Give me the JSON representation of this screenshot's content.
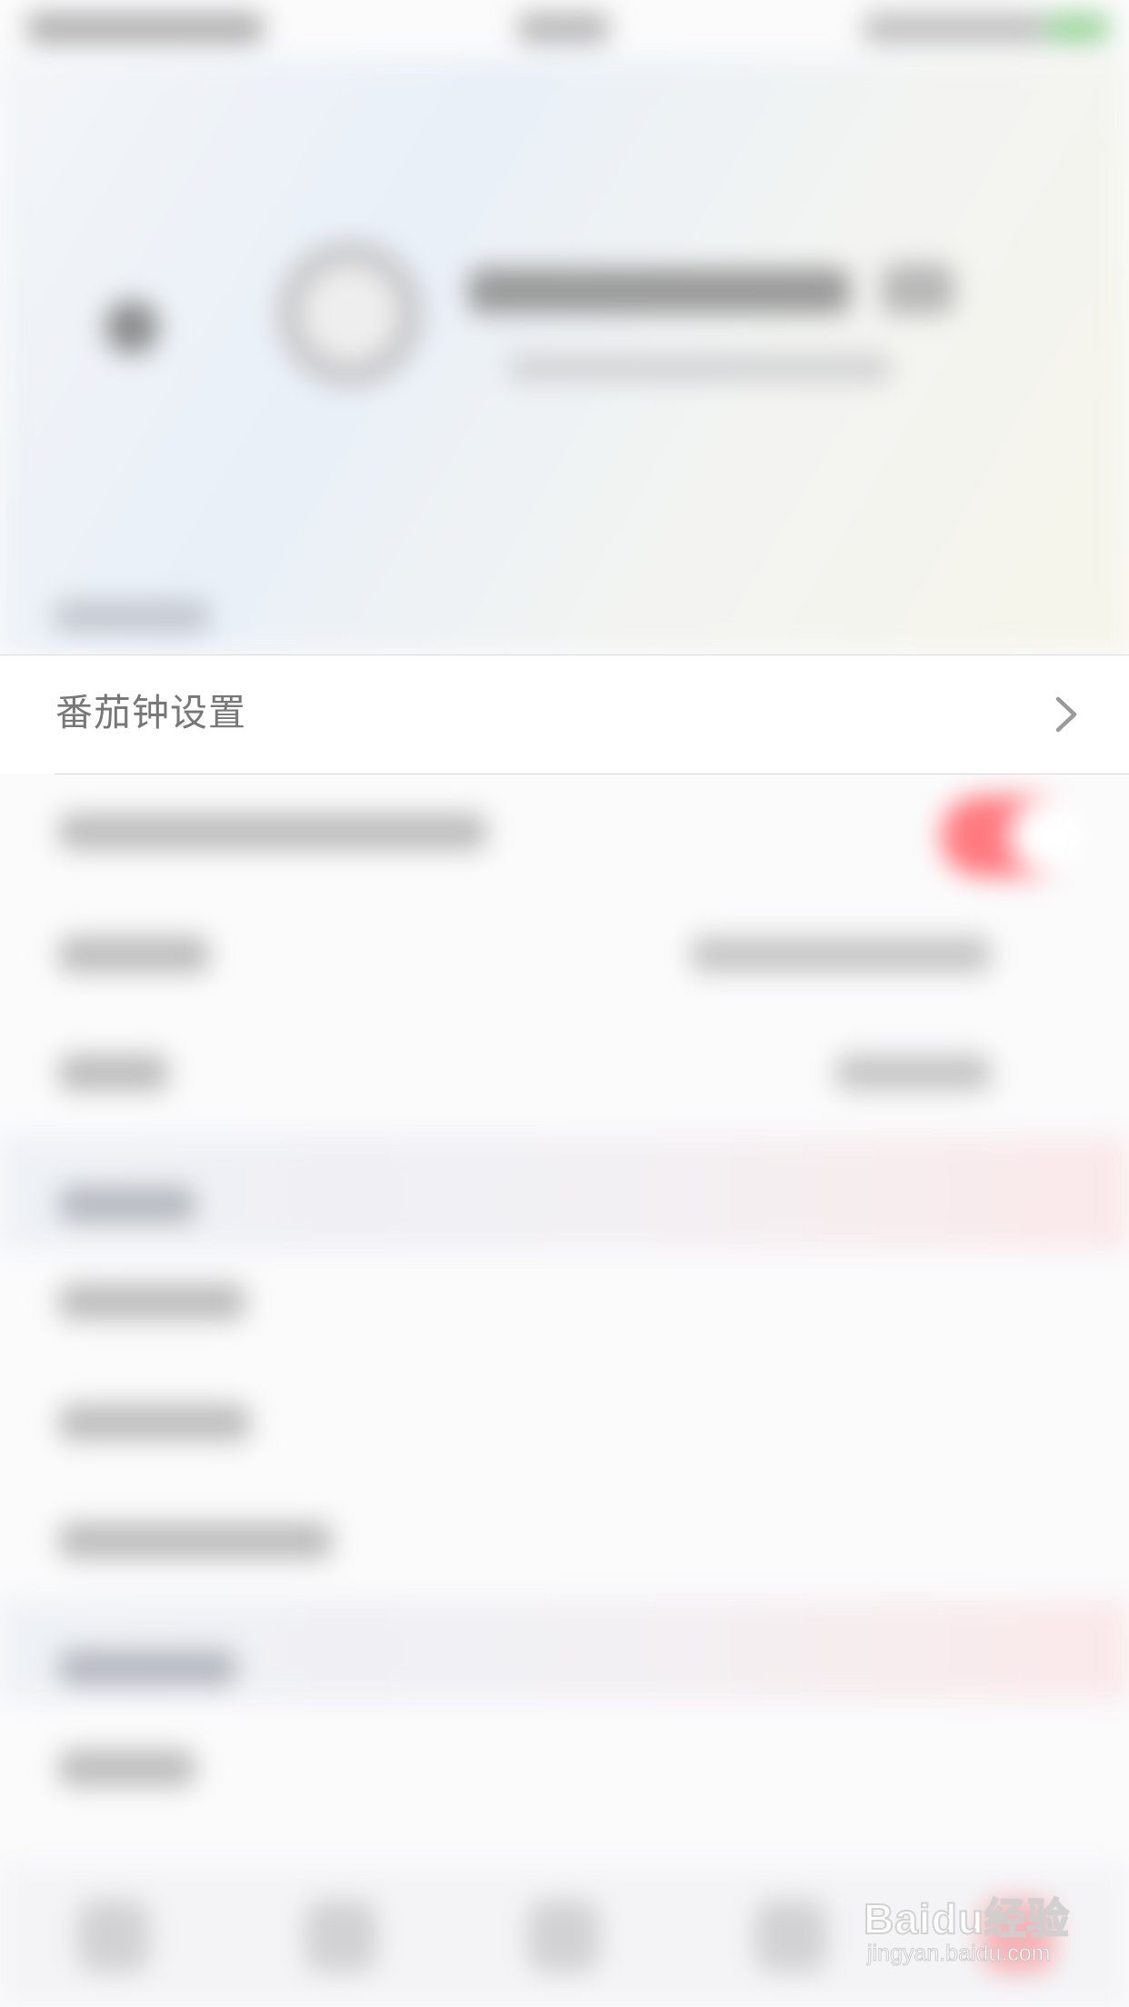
{
  "settings": {
    "pomodoro_row": {
      "label": "番茄钟设置",
      "chevron_icon": "chevron-right-icon"
    }
  },
  "watermark": {
    "brand": "Baidu经验",
    "url": "jingyan.baidu.com"
  },
  "colors": {
    "toggle_on": "#ff7a80",
    "label_text": "#777777",
    "chevron": "#9a9a9a",
    "divider": "#d9d9dc"
  }
}
